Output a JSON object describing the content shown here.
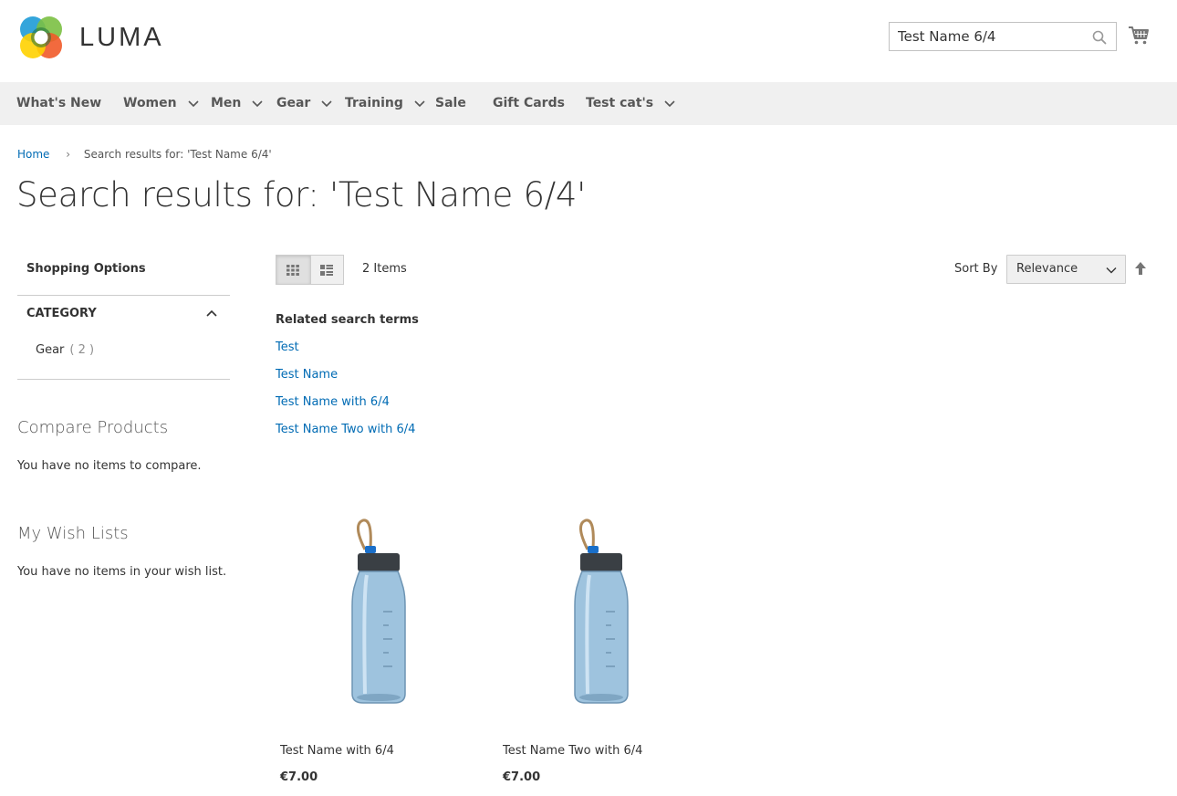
{
  "header": {
    "logo_text": "LUMA",
    "search_value": "Test Name 6/4"
  },
  "nav": {
    "items": [
      {
        "label": "What's New",
        "has_submenu": false
      },
      {
        "label": "Women",
        "has_submenu": true
      },
      {
        "label": "Men",
        "has_submenu": true
      },
      {
        "label": "Gear",
        "has_submenu": true
      },
      {
        "label": "Training",
        "has_submenu": true
      },
      {
        "label": "Sale",
        "has_submenu": false
      },
      {
        "label": "Gift Cards",
        "has_submenu": false
      },
      {
        "label": "Test cat's",
        "has_submenu": true
      }
    ]
  },
  "breadcrumb": {
    "home": "Home",
    "current": "Search results for: 'Test Name 6/4'"
  },
  "page_title": "Search results for: 'Test Name 6/4'",
  "sidebar": {
    "shopping_options": "Shopping Options",
    "category_title": "CATEGORY",
    "category_item": {
      "label": "Gear",
      "count": "( 2 )"
    },
    "compare_title": "Compare Products",
    "compare_text": "You have no items to compare.",
    "wishlist_title": "My Wish Lists",
    "wishlist_text": "You have no items in your wish list."
  },
  "toolbar": {
    "items_count": "2 Items",
    "sort_label": "Sort By",
    "sort_value": "Relevance"
  },
  "related": {
    "title": "Related search terms",
    "links": [
      "Test",
      "Test Name",
      "Test Name with 6/4",
      "Test Name Two with 6/4"
    ]
  },
  "products": [
    {
      "name": "Test Name with 6/4",
      "price": "€7.00"
    },
    {
      "name": "Test Name Two with 6/4",
      "price": "€7.00"
    }
  ],
  "colors": {
    "link": "#006bb4",
    "nav_bg": "#f0f0f0",
    "text": "#333333"
  }
}
